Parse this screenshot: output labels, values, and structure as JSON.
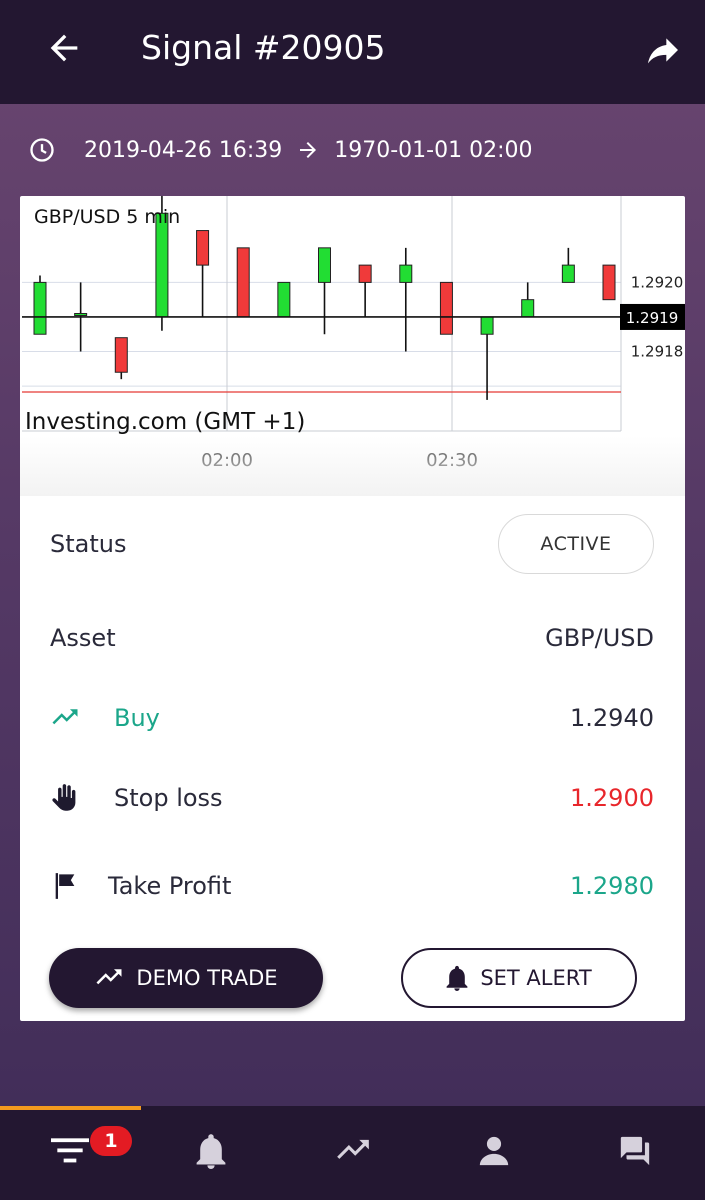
{
  "header": {
    "title": "Signal #20905"
  },
  "dates": {
    "start": "2019-04-26 16:39",
    "end": "1970-01-01 02:00"
  },
  "chart_data": {
    "type": "candlestick",
    "title": "GBP/USD 5 min",
    "source": "Investing.com (GMT +1)",
    "x_ticks": [
      "02:00",
      "02:30"
    ],
    "y_ticks": [
      "1.2920",
      "1.2918"
    ],
    "current_price": "1.2919",
    "ylim": [
      1.29157,
      1.29225
    ],
    "candles": [
      {
        "o": 1.29185,
        "h": 1.29202,
        "l": 1.29185,
        "c": 1.292
      },
      {
        "o": 1.29191,
        "h": 1.292,
        "l": 1.2918,
        "c": 1.29191
      },
      {
        "o": 1.29184,
        "h": 1.29184,
        "l": 1.29172,
        "c": 1.29174
      },
      {
        "o": 1.2919,
        "h": 1.29225,
        "l": 1.29186,
        "c": 1.2922
      },
      {
        "o": 1.29215,
        "h": 1.29215,
        "l": 1.2919,
        "c": 1.29205
      },
      {
        "o": 1.2921,
        "h": 1.2921,
        "l": 1.2919,
        "c": 1.2919
      },
      {
        "o": 1.2919,
        "h": 1.292,
        "l": 1.2919,
        "c": 1.292
      },
      {
        "o": 1.292,
        "h": 1.2921,
        "l": 1.29185,
        "c": 1.2921
      },
      {
        "o": 1.29205,
        "h": 1.29205,
        "l": 1.2919,
        "c": 1.292
      },
      {
        "o": 1.292,
        "h": 1.2921,
        "l": 1.2918,
        "c": 1.29205
      },
      {
        "o": 1.292,
        "h": 1.292,
        "l": 1.29185,
        "c": 1.29185
      },
      {
        "o": 1.29185,
        "h": 1.2919,
        "l": 1.29166,
        "c": 1.2919
      },
      {
        "o": 1.2919,
        "h": 1.292,
        "l": 1.2919,
        "c": 1.29195
      },
      {
        "o": 1.292,
        "h": 1.2921,
        "l": 1.292,
        "c": 1.29205
      },
      {
        "o": 1.29205,
        "h": 1.29205,
        "l": 1.29195,
        "c": 1.29195
      }
    ],
    "colors": {
      "up": "#22dd33",
      "down": "#f03a3a",
      "support": "#e53935"
    }
  },
  "details": {
    "status_label": "Status",
    "status_value": "ACTIVE",
    "asset_label": "Asset",
    "asset_value": "GBP/USD",
    "buy_label": "Buy",
    "buy_value": "1.2940",
    "sl_label": "Stop loss",
    "sl_value": "1.2900",
    "tp_label": "Take Profit",
    "tp_value": "1.2980"
  },
  "buttons": {
    "demo": "DEMO TRADE",
    "alert": "SET ALERT"
  },
  "nav": {
    "badge": "1",
    "items": [
      "signals-filter-icon",
      "bell-icon",
      "trending-icon",
      "person-icon",
      "chat-icon"
    ]
  },
  "colors": {
    "brand_dark": "#231731",
    "accent": "#f39a1e",
    "buy": "#1ba68a",
    "loss": "#e8262b"
  }
}
